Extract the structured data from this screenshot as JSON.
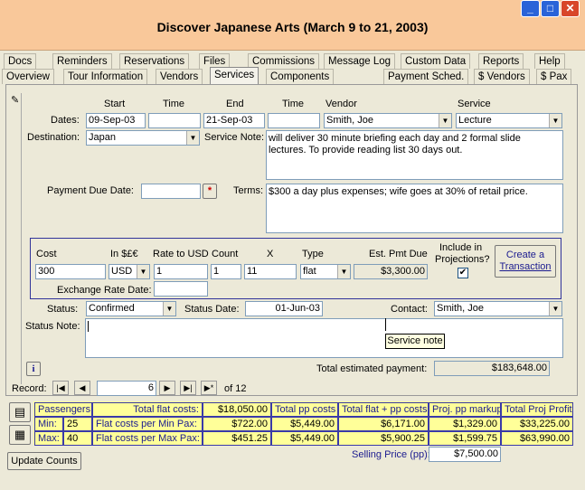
{
  "window": {
    "title": "Discover Japanese Arts (March 9 to 21, 2003)"
  },
  "tabs_row1": [
    "Docs",
    "Reminders",
    "Reservations",
    "Files",
    "Commissions",
    "Message Log",
    "Custom Data",
    "Reports",
    "Help"
  ],
  "tabs_row2": [
    "Overview",
    "Tour Information",
    "Vendors",
    "Services",
    "Components",
    "Payment Sched.",
    "$ Vendors",
    "$ Pax"
  ],
  "form": {
    "col_start": "Start",
    "col_time": "Time",
    "col_end": "End",
    "col_time2": "Time",
    "col_vendor": "Vendor",
    "col_service": "Service",
    "dates_label": "Dates:",
    "start_date": "09-Sep-03",
    "start_time": "",
    "end_date": "21-Sep-03",
    "end_time": "",
    "vendor": "Smith, Joe",
    "service": "Lecture",
    "destination_label": "Destination:",
    "destination": "Japan",
    "service_note_label": "Service Note:",
    "service_note": "will deliver 30 minute briefing each day and 2 formal slide lectures.  To provide reading list 30 days out.",
    "payment_due_label": "Payment Due Date:",
    "payment_due": "",
    "payment_due_star": "*",
    "terms_label": "Terms:",
    "terms": "$300 a day plus expenses; wife goes at 30% of retail price."
  },
  "cost": {
    "h_cost": "Cost",
    "h_currency": "In $£€",
    "h_rate": "Rate to USD",
    "h_count": "Count",
    "h_x": "X",
    "h_type": "Type",
    "h_est": "Est. Pmt Due",
    "h_include1": "Include in",
    "h_include2": "Projections?",
    "cost": "300",
    "currency": "USD",
    "rate": "1",
    "count": "1",
    "x": "11",
    "type": "flat",
    "est": "$3,300.00",
    "include_checked": "✔",
    "create_btn1": "Create a",
    "create_btn2": "Transaction",
    "exchange_label": "Exchange Rate Date:",
    "exchange_value": ""
  },
  "status": {
    "status_label": "Status:",
    "status": "Confirmed",
    "status_date_label": "Status Date:",
    "status_date": "01-Jun-03",
    "contact_label": "Contact:",
    "contact": "Smith, Joe",
    "status_note_label": "Status Note:",
    "status_note": "",
    "tooltip": "Service note"
  },
  "footer": {
    "total_label": "Total estimated payment:",
    "total_value": "$183,648.00",
    "record_label": "Record:",
    "record_value": "6",
    "record_of": "of  12"
  },
  "grid": {
    "h_passengers": "Passengers:",
    "h_total_flat": "Total flat costs:",
    "v_total_flat": "$18,050.00",
    "h_total_pp": "Total pp costs",
    "h_flat_pp": "Total flat + pp costs",
    "h_markup": "Proj. pp markup",
    "h_profit": "Total Proj Profit",
    "min_label": "Min:",
    "min_val": "25",
    "min_desc": "Flat costs per Min Pax:",
    "min_flat": "$722.00",
    "min_pp": "$5,449.00",
    "min_total": "$6,171.00",
    "min_markup": "$1,329.00",
    "min_profit": "$33,225.00",
    "max_label": "Max:",
    "max_val": "40",
    "max_desc": "Flat costs per Max Pax:",
    "max_flat": "$451.25",
    "max_pp": "$5,449.00",
    "max_total": "$5,900.25",
    "max_markup": "$1,599.75",
    "max_profit": "$63,990.00",
    "selling_label": "Selling Price (pp):",
    "selling_value": "$7,500.00"
  },
  "update_button": "Update Counts"
}
